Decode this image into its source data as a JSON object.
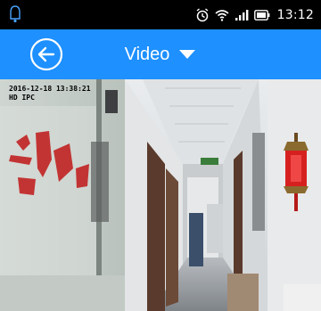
{
  "status_bar": {
    "time": "13:12",
    "icons": [
      "notification-icon",
      "alarm-icon",
      "wifi-icon",
      "signal-icon",
      "battery-icon"
    ]
  },
  "header": {
    "title": "Video",
    "back_icon": "back-arrow-icon",
    "dropdown_icon": "dropdown-triangle-icon",
    "color": "#1e90ff"
  },
  "video": {
    "osd_timestamp": "2016-12-18 13:38:21",
    "osd_quality": "HD IPC"
  }
}
